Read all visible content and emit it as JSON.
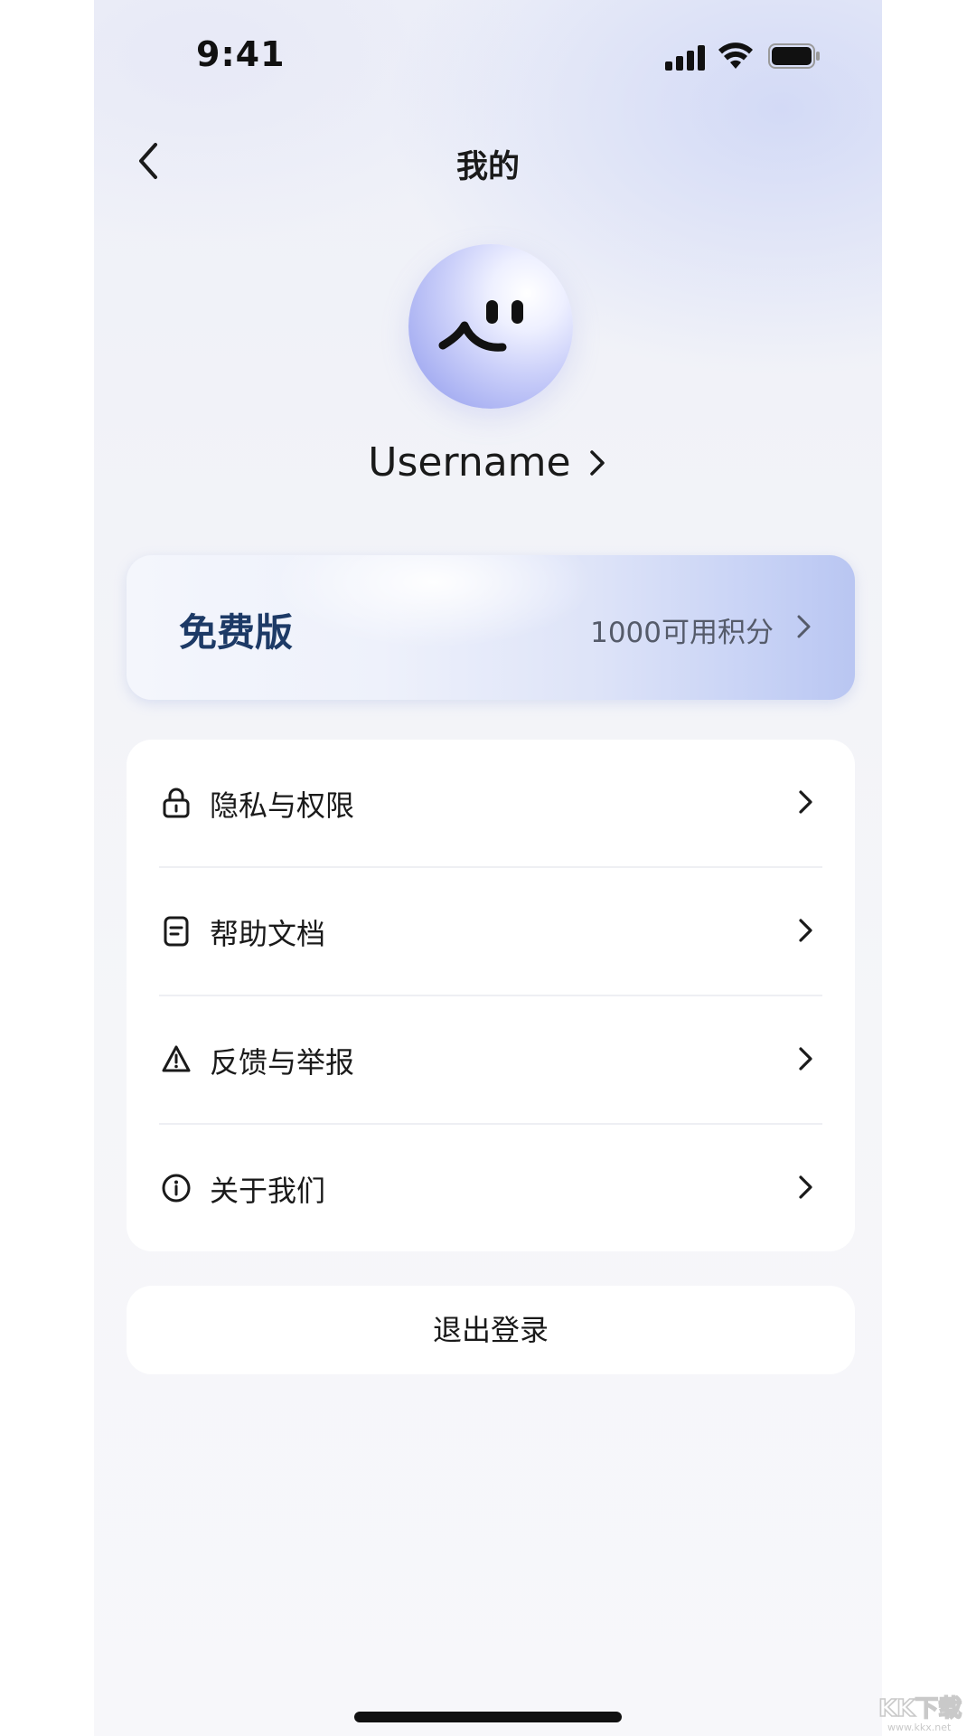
{
  "status_bar": {
    "time": "9:41"
  },
  "header": {
    "title": "我的",
    "back_icon": "chevron-left-icon"
  },
  "profile": {
    "avatar_icon": "smiley-face-icon",
    "username": "Username"
  },
  "plan": {
    "name": "免费版",
    "points_label": "1000可用积分"
  },
  "settings": {
    "items": [
      {
        "label": "隐私与权限",
        "icon": "lock-icon"
      },
      {
        "label": "帮助文档",
        "icon": "document-icon"
      },
      {
        "label": "反馈与举报",
        "icon": "warning-icon"
      },
      {
        "label": "关于我们",
        "icon": "info-icon"
      }
    ]
  },
  "logout": {
    "label": "退出登录"
  },
  "watermark": {
    "text": "KK下载",
    "url": "www.kkx.net"
  },
  "colors": {
    "plan_name": "#1d3a66",
    "text_primary": "#1a1a1a",
    "text_secondary": "#555b6a",
    "card_background": "#ffffff",
    "page_background": "#f5f6f9"
  }
}
